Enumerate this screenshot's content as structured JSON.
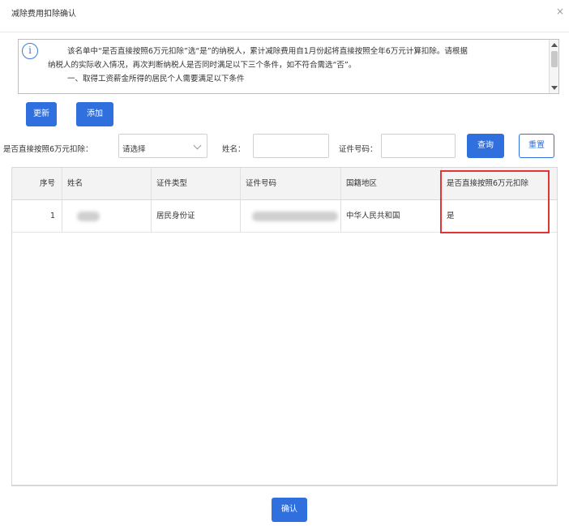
{
  "dialog": {
    "title": "减除费用扣除确认",
    "close_glyph": "×"
  },
  "notice": {
    "line1": "该名单中“是否直接按照6万元扣除”选“是”的纳税人，累计减除费用自1月份起将直接按照全年6万元计算扣除。请根据",
    "line2": "纳税人的实际收入情况，再次判断纳税人是否同时满足以下三个条件，如不符合需选“否”。",
    "line3": "一、取得工资薪金所得的居民个人需要满足以下条件"
  },
  "toolbar": {
    "update_label": "更新",
    "add_label": "添加"
  },
  "filters": {
    "flag_label": "是否直接按照6万元扣除：",
    "flag_value": "请选择",
    "name_label": "姓名：",
    "name_value": "",
    "id_label": "证件号码：",
    "id_value": "",
    "query_label": "查询",
    "reset_label": "重置"
  },
  "table": {
    "headers": {
      "seq": "序号",
      "name": "姓名",
      "id_type": "证件类型",
      "id_number": "证件号码",
      "region": "国籍地区",
      "flag": "是否直接按照6万元扣除"
    },
    "rows": [
      {
        "seq": "1",
        "name": "",
        "id_type": "居民身份证",
        "id_number": "",
        "region": "中华人民共和国",
        "flag": "是"
      }
    ]
  },
  "footer": {
    "confirm_label": "确认"
  },
  "colors": {
    "primary": "#2f6fde",
    "highlight": "#e03535"
  }
}
